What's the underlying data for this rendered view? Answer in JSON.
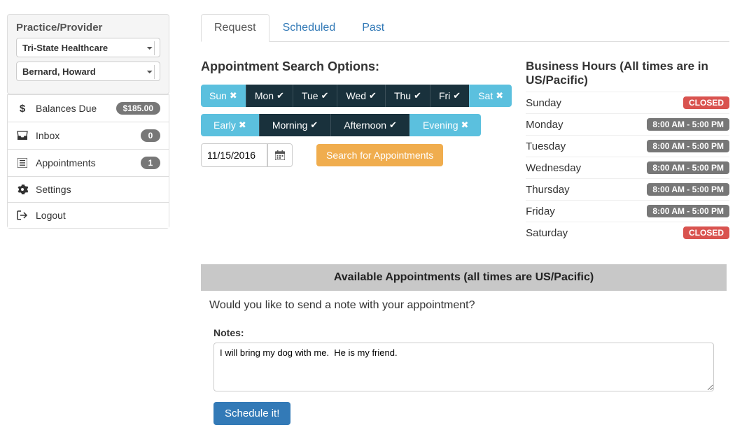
{
  "sidebar": {
    "panel_title": "Practice/Provider",
    "practice_value": "Tri-State Healthcare",
    "provider_value": "Bernard, Howard",
    "items": [
      {
        "icon": "dollar",
        "label": "Balances Due",
        "badge": "$185.00",
        "badge_class": "money"
      },
      {
        "icon": "inbox",
        "label": "Inbox",
        "badge": "0"
      },
      {
        "icon": "list",
        "label": "Appointments",
        "badge": "1"
      },
      {
        "icon": "gear",
        "label": "Settings",
        "badge": ""
      },
      {
        "icon": "logout",
        "label": "Logout",
        "badge": ""
      }
    ]
  },
  "tabs": {
    "request": "Request",
    "scheduled": "Scheduled",
    "past": "Past"
  },
  "search": {
    "heading": "Appointment Search Options:",
    "days": [
      {
        "label": "Sun",
        "selected": false
      },
      {
        "label": "Mon",
        "selected": true
      },
      {
        "label": "Tue",
        "selected": true
      },
      {
        "label": "Wed",
        "selected": true
      },
      {
        "label": "Thu",
        "selected": true
      },
      {
        "label": "Fri",
        "selected": true
      },
      {
        "label": "Sat",
        "selected": false
      }
    ],
    "periods": [
      {
        "label": "Early",
        "selected": false
      },
      {
        "label": "Morning",
        "selected": true
      },
      {
        "label": "Afternoon",
        "selected": true
      },
      {
        "label": "Evening",
        "selected": false
      }
    ],
    "date_value": "11/15/2016",
    "search_button": "Search for Appointments"
  },
  "business_hours": {
    "title": "Business Hours (All times are in US/Pacific)",
    "rows": [
      {
        "day": "Sunday",
        "text": "CLOSED",
        "closed": true
      },
      {
        "day": "Monday",
        "text": "8:00 AM - 5:00 PM",
        "closed": false
      },
      {
        "day": "Tuesday",
        "text": "8:00 AM - 5:00 PM",
        "closed": false
      },
      {
        "day": "Wednesday",
        "text": "8:00 AM - 5:00 PM",
        "closed": false
      },
      {
        "day": "Thursday",
        "text": "8:00 AM - 5:00 PM",
        "closed": false
      },
      {
        "day": "Friday",
        "text": "8:00 AM - 5:00 PM",
        "closed": false
      },
      {
        "day": "Saturday",
        "text": "CLOSED",
        "closed": true
      }
    ]
  },
  "available": {
    "bar_text": "Available Appointments (all times are US/Pacific)",
    "note_question": "Would you like to send a note with your appointment?",
    "notes_label": "Notes:",
    "notes_value": "I will bring my dog with me.  He is my friend.",
    "schedule_button": "Schedule it!"
  }
}
